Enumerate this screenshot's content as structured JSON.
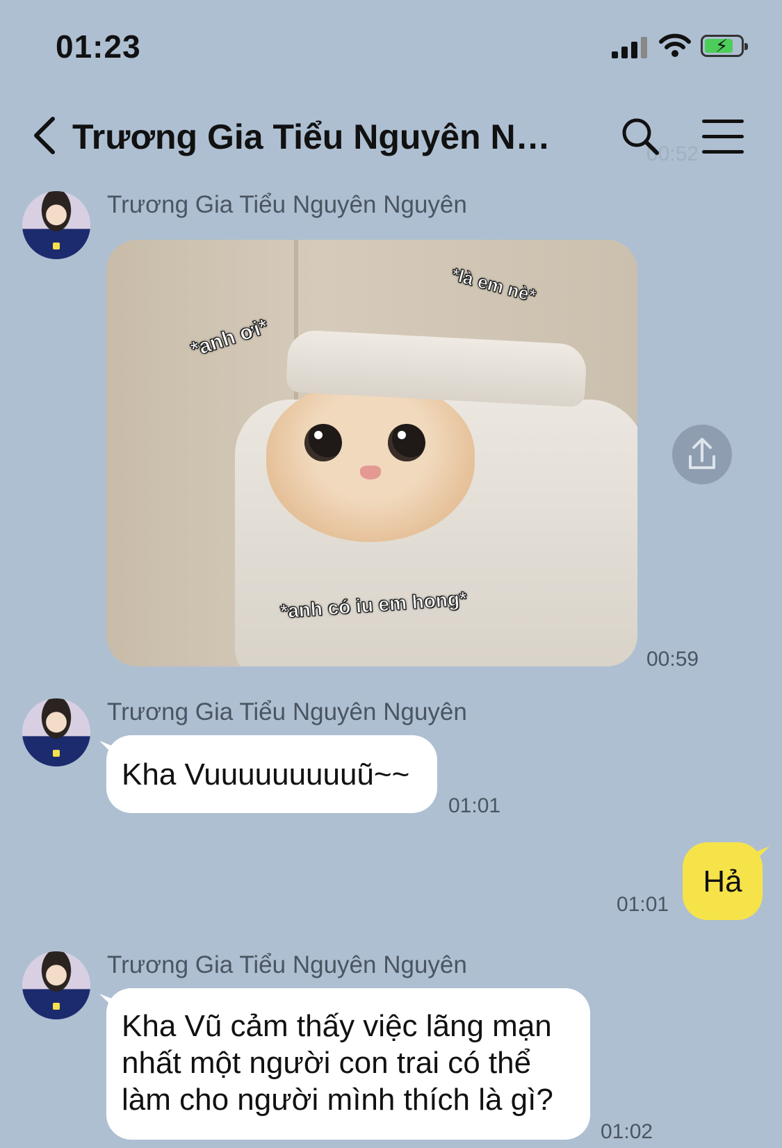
{
  "status_bar": {
    "time": "01:23"
  },
  "header": {
    "title": "Trương Gia Tiểu Nguyên Ng...",
    "faded_time": "00:52"
  },
  "messages": [
    {
      "sender": "Trương Gia Tiểu Nguyên Nguyên",
      "type": "image",
      "image_captions": [
        "*anh ơi*",
        "*là em nè*",
        "*anh có iu em hong*"
      ],
      "time": "00:59"
    },
    {
      "sender": "Trương Gia Tiểu Nguyên Nguyên",
      "type": "text",
      "text": "Kha Vuuuuuuuuuũ~~",
      "time": "01:01"
    },
    {
      "sender": "me",
      "type": "text",
      "text": "Hả",
      "time": "01:01"
    },
    {
      "sender": "Trương Gia Tiểu Nguyên Nguyên",
      "type": "text",
      "lines": [
        "Kha Vũ cảm thấy việc lãng mạn",
        "nhất một người con trai có thể",
        "làm cho người mình thích là gì?"
      ],
      "time": "01:02"
    }
  ],
  "colors": {
    "background": "#aebfd2",
    "my_bubble": "#f6e34a",
    "their_bubble": "#ffffff"
  },
  "icons": [
    "back-icon",
    "search-icon",
    "menu-icon",
    "share-icon",
    "signal-icon",
    "wifi-icon",
    "battery-icon"
  ]
}
